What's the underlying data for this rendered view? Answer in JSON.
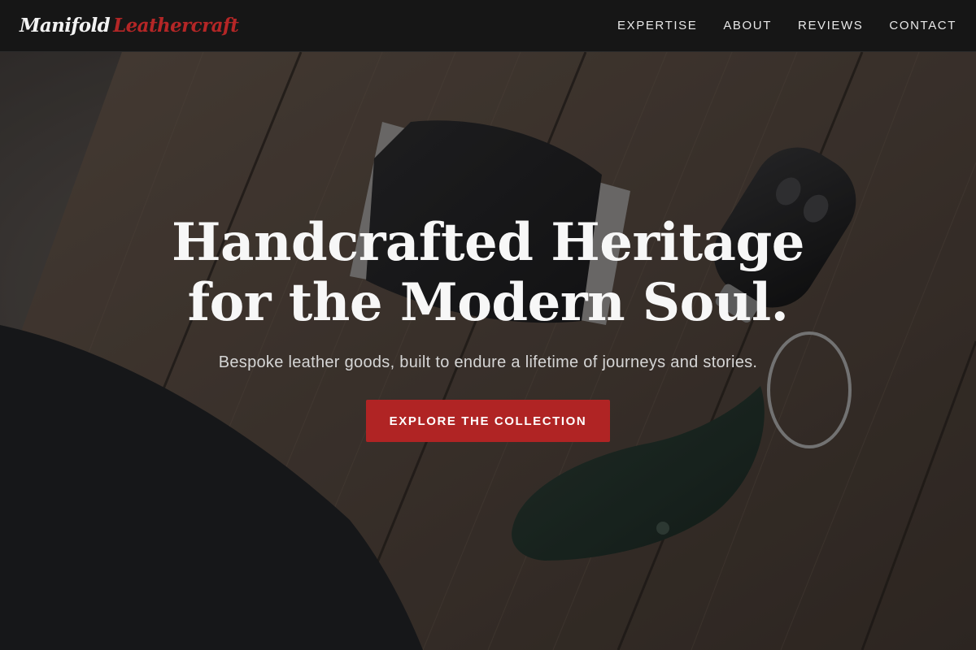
{
  "brand": {
    "name_part1": "Manifold",
    "name_part2": "Leathercraft",
    "accent_color": "#b42626"
  },
  "nav": {
    "items": [
      {
        "label": "EXPERTISE"
      },
      {
        "label": "ABOUT"
      },
      {
        "label": "REVIEWS"
      },
      {
        "label": "CONTACT"
      }
    ]
  },
  "hero": {
    "title": "Handcrafted Heritage for the Modern Soul.",
    "subtitle": "Bespoke leather goods, built to endure a lifetime of journeys and stories.",
    "cta_label": "EXPLORE THE COLLECTION",
    "cta_color": "#b02424",
    "background_image": "photo of leather card wallet and car key fob with leather key pouch on dark wooden planks"
  }
}
